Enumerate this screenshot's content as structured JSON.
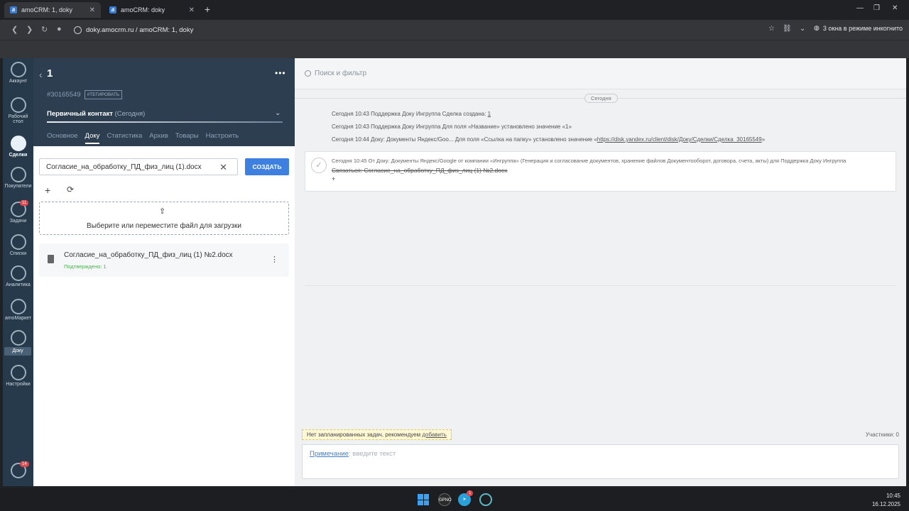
{
  "browser": {
    "tabs": [
      {
        "title": "amoCRM: 1, doky",
        "active": true
      },
      {
        "title": "amoCRM: doky",
        "active": false
      }
    ],
    "url": "doky.amocrm.ru / amoCRM: 1, doky",
    "incognito": "3 окна в режиме инкогнито"
  },
  "leftnav": {
    "items": [
      {
        "label": "Аккаунт"
      },
      {
        "label": "Рабочий стол"
      },
      {
        "label": "Сделки"
      },
      {
        "label": "Покупатели"
      },
      {
        "label": "Задачи",
        "badge": "11"
      },
      {
        "label": "Списки"
      },
      {
        "label": "Аналитика"
      },
      {
        "label": "amoМаркет"
      },
      {
        "label": "Доку"
      },
      {
        "label": "Настройки"
      }
    ],
    "chat_badge": "14",
    "tooltip": "Доку"
  },
  "deal": {
    "title": "1",
    "id": "#30165549",
    "tag_button": "#ТЕГИРОВАТЬ",
    "stage": "Первичный контакт",
    "stage_date": "(Сегодня)",
    "tabs": [
      "Основное",
      "Доку",
      "Статистика",
      "Архив",
      "Товары",
      "Настроить"
    ],
    "active_tab": "Доку"
  },
  "doku": {
    "input_value": "Согласие_на_обработку_ПД_физ_лиц (1).docx",
    "create_label": "СОЗДАТЬ",
    "dropzone_text": "Выберите или переместите файл для загрузки",
    "file_name": "Согласие_на_обработку_ПД_физ_лиц (1) №2.docx",
    "file_status": "Подтверждено: 1"
  },
  "feed": {
    "search_placeholder": "Поиск и фильтр",
    "day": "Сегодня",
    "events": [
      {
        "text": "Сегодня 10:43 Поддержка Доку Ингруппа Сделка создана: ",
        "link": "1"
      },
      {
        "text": "Сегодня 10:43 Поддержка Доку Ингруппа Для поля «Название» установлено значение «1»",
        "link": ""
      },
      {
        "text": "Сегодня 10:44 Доку: Документы Яндекс/Goo... Для поля «Ссылка на папку» установлено значение «",
        "link": "https://disk.yandex.ru/client/disk/Доку/Сделки/Сделка_30165549",
        "suffix": "»"
      }
    ],
    "note": {
      "meta": "Сегодня 10:45   От Доку: Документы Яндекс/Google от компании «Ингруппа» (Генерация и согласование документов, хранение файлов Документооборот, договора, счета, акты) для Поддержка Доку Ингруппа",
      "text": "Связаться: Согласие_на_обработку_ПД_физ_лиц (1) №2.docx",
      "plus": "+"
    },
    "tasks_warning": "Нет запланированных задач, рекомендуем ",
    "tasks_link": "добавить",
    "participants": "Участники: 0",
    "compose_link": "Примечание",
    "compose_placeholder": ": введите текст"
  },
  "taskbar": {
    "time": "10:45",
    "date": "16.12.2025",
    "telegram_badge": "1"
  }
}
